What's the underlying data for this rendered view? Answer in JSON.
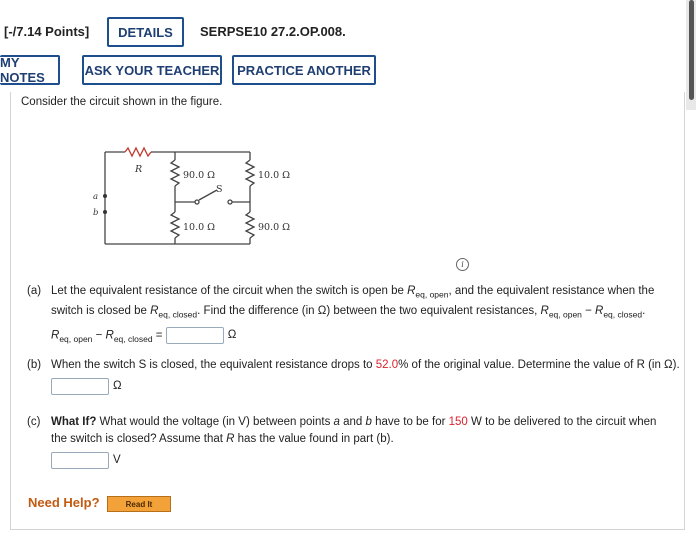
{
  "header": {
    "points": "[-/7.14 Points]",
    "details_label": "DETAILS",
    "problem_id": "SERPSE10 27.2.OP.008.",
    "my_notes_label": "MY NOTES",
    "ask_teacher_label": "ASK YOUR TEACHER",
    "practice_label": "PRACTICE ANOTHER"
  },
  "intro": "Consider the circuit shown in the figure.",
  "figure": {
    "r_label": "R",
    "r_top_mid": "90.0 Ω",
    "r_top_right": "10.0 Ω",
    "r_bot_mid": "10.0 Ω",
    "r_bot_right": "90.0 Ω",
    "switch_label": "S",
    "node_a": "a",
    "node_b": "b"
  },
  "parts": {
    "a": {
      "label": "(a)",
      "t1": "Let the equivalent resistance of the circuit when the switch is open be ",
      "t2": " and the equivalent resistance when the",
      "t3": "switch is closed be ",
      "t4": " Find the difference (in Ω) between the two equivalent resistances, ",
      "t5": " − ",
      "expr_minus": " − ",
      "eq": " =",
      "unit": "Ω",
      "req": "R",
      "sub_open": "eq, open",
      "sub_closed": "eq, closed",
      "sub_open_comma": "eq, open",
      "sub_closed_dot": "eq, closed",
      "comma": ",",
      "dot": "."
    },
    "b": {
      "label": "(b)",
      "t1": "When the switch S is closed, the equivalent resistance drops to ",
      "percent": "52.0",
      "t2": "% of the original value. Determine the value of R (in Ω).",
      "unit": "Ω"
    },
    "c": {
      "label": "(c)",
      "bold": "What If?",
      "t1": " What would the voltage (in V) between points ",
      "a": "a",
      "t2": " and ",
      "b": "b",
      "t3": " have to be for ",
      "watts": "150",
      "t4": " W to be delivered to the circuit when",
      "t5": "the switch is closed? Assume that ",
      "r": "R",
      "t6": " has the value found in part (b).",
      "unit": "V"
    }
  },
  "help": {
    "need_help": "Need Help?",
    "read_it": "Read It"
  },
  "colors": {
    "accent": "#1f4e8c",
    "highlight": "#d9232e",
    "help": "#c25a10",
    "read_it_bg": "#f2a238"
  },
  "icons": {
    "info": "info-icon"
  }
}
